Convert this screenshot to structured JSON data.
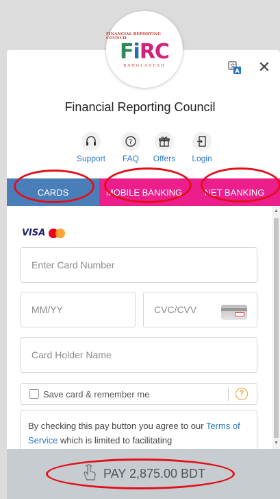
{
  "header": {
    "logo": {
      "top_text": "FINANCIAL REPORTING COUNCIL",
      "main_text": "FiRC",
      "bottom_text": "BANGLADESH"
    },
    "org_name": "Financial Reporting Council",
    "close_glyph": "✕"
  },
  "toolbar": [
    {
      "label": "Support",
      "icon": "headset-icon"
    },
    {
      "label": "FAQ",
      "icon": "question-icon"
    },
    {
      "label": "Offers",
      "icon": "gift-icon"
    },
    {
      "label": "Login",
      "icon": "login-icon"
    }
  ],
  "tabs": [
    {
      "label": "CARDS",
      "active": true
    },
    {
      "label": "MOBILE BANKING",
      "active": false
    },
    {
      "label": "NET BANKING",
      "active": false
    }
  ],
  "card_form": {
    "brands": [
      "VISA",
      "Mastercard"
    ],
    "card_number_placeholder": "Enter Card Number",
    "expiry_placeholder": "MM/YY",
    "cvc_placeholder": "CVC/CVV",
    "holder_placeholder": "Card Holder Name",
    "save_card_label": "Save card & remember me",
    "save_card_checked": false,
    "help_glyph": "?",
    "terms_prefix": "By checking this pay button you agree to our",
    "terms_link": "Terms of Service",
    "terms_suffix": "which is limited to facilitating"
  },
  "pay_button": {
    "label": "PAY 2,875.00 BDT"
  },
  "colors": {
    "active_tab": "#4a7eb8",
    "inactive_tab": "#ec1e8c",
    "link": "#2b78c5",
    "annotation_ring": "#e0101a",
    "pay_bar": "#c7ccd1"
  }
}
